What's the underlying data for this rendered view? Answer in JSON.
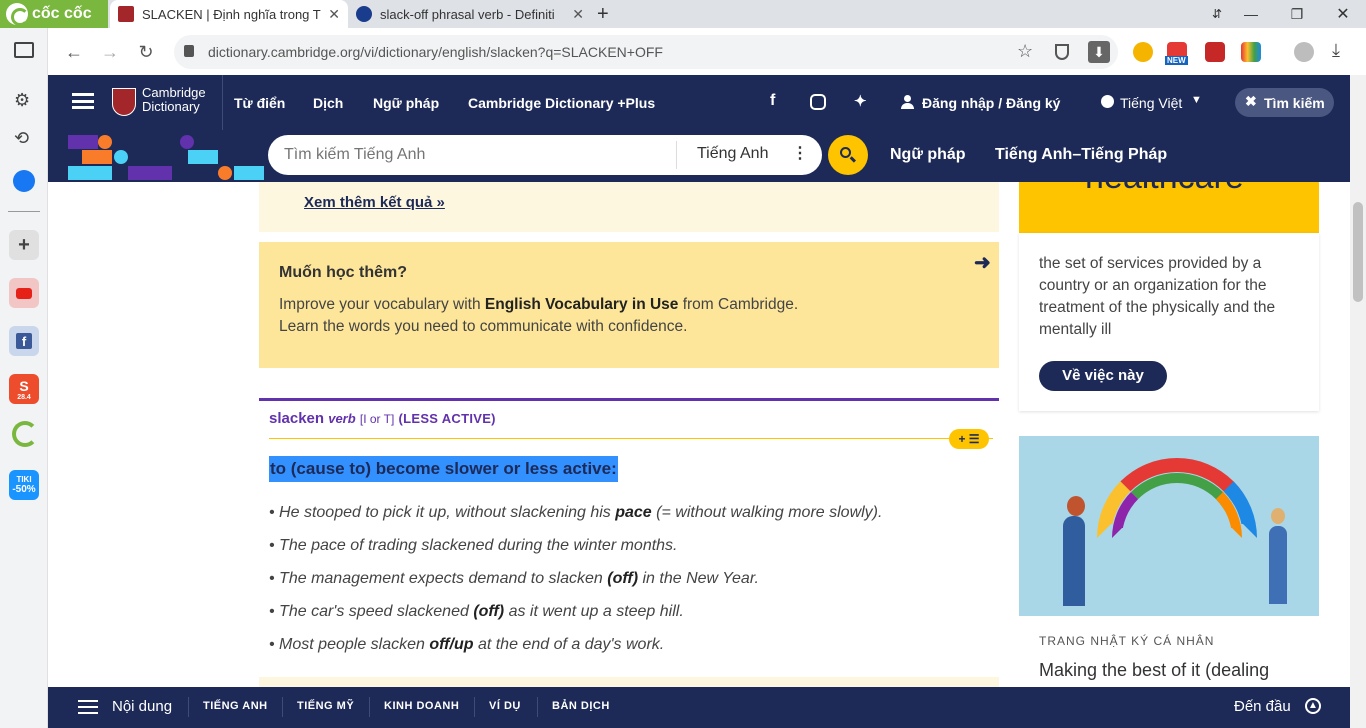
{
  "browser": {
    "brand": "cốc cốc",
    "tabs": [
      {
        "title": "SLACKEN | Định nghĩa trong T",
        "active": true
      },
      {
        "title": "slack-off phrasal verb - Definiti",
        "active": false
      }
    ],
    "new_tab": "+",
    "url": "dictionary.cambridge.org/vi/dictionary/english/slacken?q=SLACKEN+OFF",
    "badge_new": "NEW"
  },
  "sidebar": {
    "tiki_label": "TIKI",
    "tiki_discount": "-50%",
    "shopee_date": "28.4"
  },
  "header": {
    "logo_line1": "Cambridge",
    "logo_line2": "Dictionary",
    "nav": [
      "Từ điển",
      "Dịch",
      "Ngữ pháp",
      "Cambridge Dictionary +Plus"
    ],
    "login": "Đăng nhập / Đăng ký",
    "language": "Tiếng Việt",
    "search_toggle": "Tìm kiếm"
  },
  "searchbar": {
    "placeholder": "Tìm kiếm Tiếng Anh",
    "dict_select": "Tiếng Anh",
    "links": [
      "Ngữ pháp",
      "Tiếng Anh–Tiếng Pháp"
    ]
  },
  "content": {
    "more_results": "Xem thêm kết quả »",
    "learn_title": "Muốn học thêm?",
    "learn_line1_pre": "Improve your vocabulary with ",
    "learn_line1_bold": "English Vocabulary in Use",
    "learn_line1_post": " from Cambridge.",
    "learn_line2": "Learn the words you need to communicate with confidence.",
    "entry": {
      "headword": "slacken",
      "pos": "verb",
      "grammar": "[I or T]",
      "guideword": "(LESS ACTIVE)",
      "definition": "to (cause to) become slower or less active:",
      "examples": [
        {
          "pre": "He stooped to pick it up, without slackening his ",
          "bold": "pace",
          "post": " (= without walking more slowly)."
        },
        {
          "pre": "The pace of trading slackened during the winter months.",
          "bold": "",
          "post": ""
        },
        {
          "pre": "The management expects demand to slacken ",
          "bold": "(off)",
          "post": " in the New Year."
        },
        {
          "pre": "The car's speed slackened ",
          "bold": "(off)",
          "post": " as it went up a steep hill."
        },
        {
          "pre": "Most people slacken ",
          "bold": "off/up",
          "post": " at the end of a day's work."
        }
      ]
    }
  },
  "ad": {
    "word": "healthcare",
    "definition": "the set of services provided by a country or an organization for the treatment of the physically and the mentally ill",
    "button": "Về việc này",
    "blog_label": "TRANG NHẬT KÝ CÁ NHÂN",
    "blog_title": "Making the best of it (dealing"
  },
  "bottombar": {
    "menu": "Nội dung",
    "links": [
      "TIẾNG ANH",
      "TIẾNG MỸ",
      "KINH DOANH",
      "VÍ DỤ",
      "BẢN DỊCH"
    ],
    "top": "Đến đầu"
  },
  "colors": {
    "navy": "#1d2a57",
    "yellow": "#fec400",
    "purple": "#6231ac",
    "highlight": "#3390ff"
  }
}
